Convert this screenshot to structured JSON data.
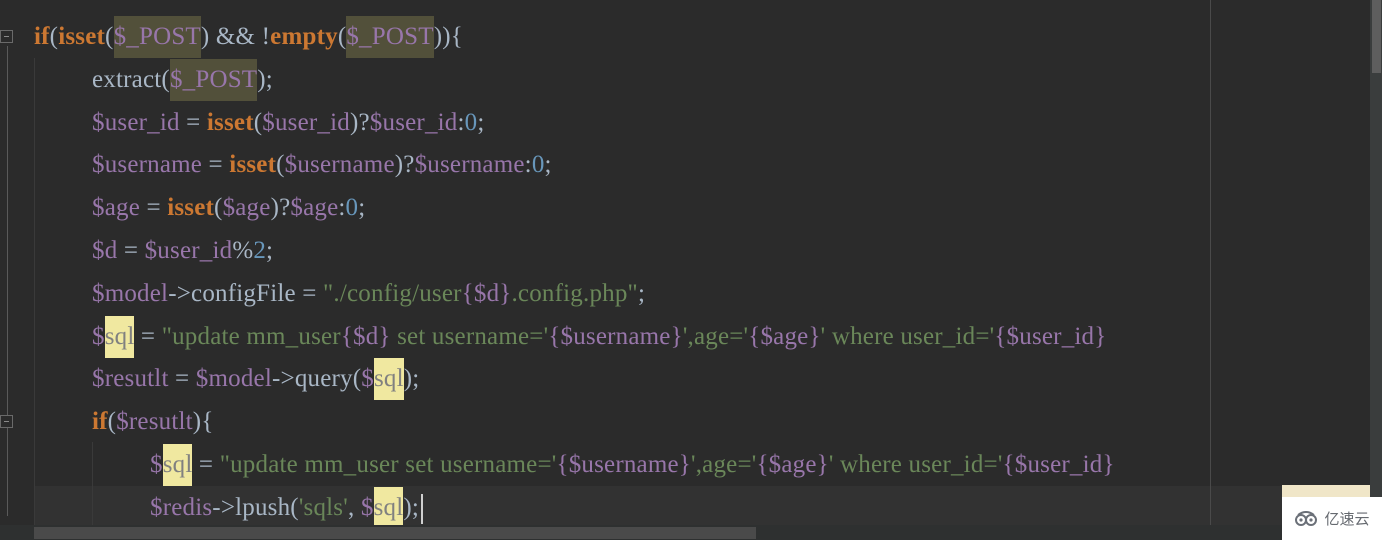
{
  "editor": {
    "language": "php",
    "lines": [
      {
        "indent": 0,
        "fold": true,
        "tokens": [
          {
            "t": "if",
            "c": "kw"
          },
          {
            "t": "(",
            "c": "punc"
          },
          {
            "t": "isset",
            "c": "kw"
          },
          {
            "t": "(",
            "c": "punc"
          },
          {
            "t": "$_POST",
            "c": "var",
            "hl": "dark"
          },
          {
            "t": ") && !",
            "c": "op"
          },
          {
            "t": "empty",
            "c": "kw"
          },
          {
            "t": "(",
            "c": "punc"
          },
          {
            "t": "$_POST",
            "c": "var",
            "hl": "dark"
          },
          {
            "t": ")){",
            "c": "punc"
          }
        ]
      },
      {
        "indent": 1,
        "tokens": [
          {
            "t": "extract",
            "c": "fn"
          },
          {
            "t": "(",
            "c": "punc"
          },
          {
            "t": "$_POST",
            "c": "var",
            "hl": "dark"
          },
          {
            "t": ");",
            "c": "punc"
          }
        ]
      },
      {
        "indent": 1,
        "tokens": [
          {
            "t": "$user_id",
            "c": "var"
          },
          {
            "t": " = ",
            "c": "op"
          },
          {
            "t": "isset",
            "c": "kw"
          },
          {
            "t": "(",
            "c": "punc"
          },
          {
            "t": "$user_id",
            "c": "var"
          },
          {
            "t": ")?",
            "c": "punc"
          },
          {
            "t": "$user_id",
            "c": "var"
          },
          {
            "t": ":",
            "c": "punc"
          },
          {
            "t": "0",
            "c": "num"
          },
          {
            "t": ";",
            "c": "punc"
          }
        ]
      },
      {
        "indent": 1,
        "tokens": [
          {
            "t": "$username",
            "c": "var"
          },
          {
            "t": " = ",
            "c": "op"
          },
          {
            "t": "isset",
            "c": "kw"
          },
          {
            "t": "(",
            "c": "punc"
          },
          {
            "t": "$username",
            "c": "var"
          },
          {
            "t": ")?",
            "c": "punc"
          },
          {
            "t": "$username",
            "c": "var"
          },
          {
            "t": ":",
            "c": "punc"
          },
          {
            "t": "0",
            "c": "num"
          },
          {
            "t": ";",
            "c": "punc"
          }
        ]
      },
      {
        "indent": 1,
        "tokens": [
          {
            "t": "$age",
            "c": "var"
          },
          {
            "t": " = ",
            "c": "op"
          },
          {
            "t": "isset",
            "c": "kw"
          },
          {
            "t": "(",
            "c": "punc"
          },
          {
            "t": "$age",
            "c": "var"
          },
          {
            "t": ")?",
            "c": "punc"
          },
          {
            "t": "$age",
            "c": "var"
          },
          {
            "t": ":",
            "c": "punc"
          },
          {
            "t": "0",
            "c": "num"
          },
          {
            "t": ";",
            "c": "punc"
          }
        ]
      },
      {
        "indent": 1,
        "tokens": [
          {
            "t": "$d",
            "c": "var"
          },
          {
            "t": " = ",
            "c": "op"
          },
          {
            "t": "$user_id",
            "c": "var"
          },
          {
            "t": "%",
            "c": "op"
          },
          {
            "t": "2",
            "c": "num"
          },
          {
            "t": ";",
            "c": "punc"
          }
        ]
      },
      {
        "indent": 1,
        "tokens": [
          {
            "t": "$model",
            "c": "var"
          },
          {
            "t": "->configFile = ",
            "c": "op"
          },
          {
            "t": "\"./config/user",
            "c": "str"
          },
          {
            "t": "{$d}",
            "c": "var"
          },
          {
            "t": ".config.php\"",
            "c": "str"
          },
          {
            "t": ";",
            "c": "punc"
          }
        ]
      },
      {
        "indent": 1,
        "tokens": [
          {
            "t": "$",
            "c": "var"
          },
          {
            "t": "sql",
            "c": "var",
            "hl": "yellow"
          },
          {
            "t": " = ",
            "c": "op"
          },
          {
            "t": "\"update mm_user",
            "c": "str"
          },
          {
            "t": "{$d}",
            "c": "var"
          },
          {
            "t": " set username='",
            "c": "str"
          },
          {
            "t": "{$username}",
            "c": "var"
          },
          {
            "t": "',age='",
            "c": "str"
          },
          {
            "t": "{$age}",
            "c": "var"
          },
          {
            "t": "' where user_id='",
            "c": "str"
          },
          {
            "t": "{$user_id}",
            "c": "var"
          }
        ]
      },
      {
        "indent": 1,
        "tokens": [
          {
            "t": "$resutlt",
            "c": "var"
          },
          {
            "t": " = ",
            "c": "op"
          },
          {
            "t": "$model",
            "c": "var"
          },
          {
            "t": "->query(",
            "c": "op"
          },
          {
            "t": "$",
            "c": "var"
          },
          {
            "t": "sql",
            "c": "var",
            "hl": "yellow"
          },
          {
            "t": ");",
            "c": "punc"
          }
        ]
      },
      {
        "indent": 1,
        "fold": true,
        "tokens": [
          {
            "t": "if",
            "c": "kw"
          },
          {
            "t": "(",
            "c": "punc"
          },
          {
            "t": "$resutlt",
            "c": "var"
          },
          {
            "t": "){",
            "c": "punc"
          }
        ]
      },
      {
        "indent": 2,
        "tokens": [
          {
            "t": "$",
            "c": "var"
          },
          {
            "t": "sql",
            "c": "var",
            "hl": "yellow"
          },
          {
            "t": " = ",
            "c": "op"
          },
          {
            "t": "\"update mm_user set username='",
            "c": "str"
          },
          {
            "t": "{$username}",
            "c": "var"
          },
          {
            "t": "',age='",
            "c": "str"
          },
          {
            "t": "{$age}",
            "c": "var"
          },
          {
            "t": "' where user_id='",
            "c": "str"
          },
          {
            "t": "{$user_id}",
            "c": "var"
          }
        ]
      },
      {
        "indent": 2,
        "current": true,
        "caret": true,
        "tokens": [
          {
            "t": "$redis",
            "c": "var"
          },
          {
            "t": "->lpush(",
            "c": "op"
          },
          {
            "t": "'sqls'",
            "c": "str"
          },
          {
            "t": ", ",
            "c": "punc"
          },
          {
            "t": "$",
            "c": "var"
          },
          {
            "t": "sql",
            "c": "var",
            "hl": "yellow"
          },
          {
            "t": ");",
            "c": "punc"
          }
        ]
      }
    ]
  },
  "watermark": {
    "icon": "cloud-logo-icon",
    "text": "亿速云"
  }
}
